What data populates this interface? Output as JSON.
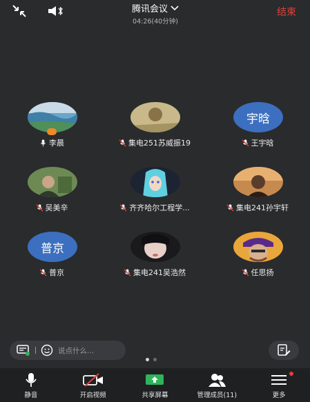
{
  "header": {
    "title": "腾讯会议",
    "elapsed": "04:26(40分钟)",
    "end_label": "结束"
  },
  "participants": [
    {
      "name": "李晨",
      "avatar_type": "photo",
      "mic": "on",
      "host": true
    },
    {
      "name": "集电251苏威振19",
      "avatar_type": "photo",
      "mic": "muted"
    },
    {
      "name": "王宇晗",
      "avatar_type": "text",
      "avatar_text": "宇晗",
      "mic": "muted"
    },
    {
      "name": "吴美辛",
      "avatar_type": "photo",
      "mic": "muted"
    },
    {
      "name": "齐齐哈尔工程学...",
      "avatar_type": "photo",
      "mic": "muted"
    },
    {
      "name": "集电241孙宇轩",
      "avatar_type": "photo",
      "mic": "muted"
    },
    {
      "name": "普京",
      "avatar_type": "text",
      "avatar_text": "普京",
      "mic": "muted"
    },
    {
      "name": "集电241吴浩然",
      "avatar_type": "photo",
      "mic": "muted"
    },
    {
      "name": "任思扬",
      "avatar_type": "photo",
      "mic": "muted"
    }
  ],
  "chat": {
    "placeholder": "说点什么..."
  },
  "pager": {
    "current": 1,
    "total": 2
  },
  "toolbar": {
    "mute": "静音",
    "video": "开启视频",
    "share": "共享屏幕",
    "members": "管理成员(11)",
    "more": "更多"
  },
  "colors": {
    "background": "#2a2b2d",
    "end": "#e0403a",
    "text_avatar": "#3c6fbf",
    "share_green": "#2fb35b"
  }
}
